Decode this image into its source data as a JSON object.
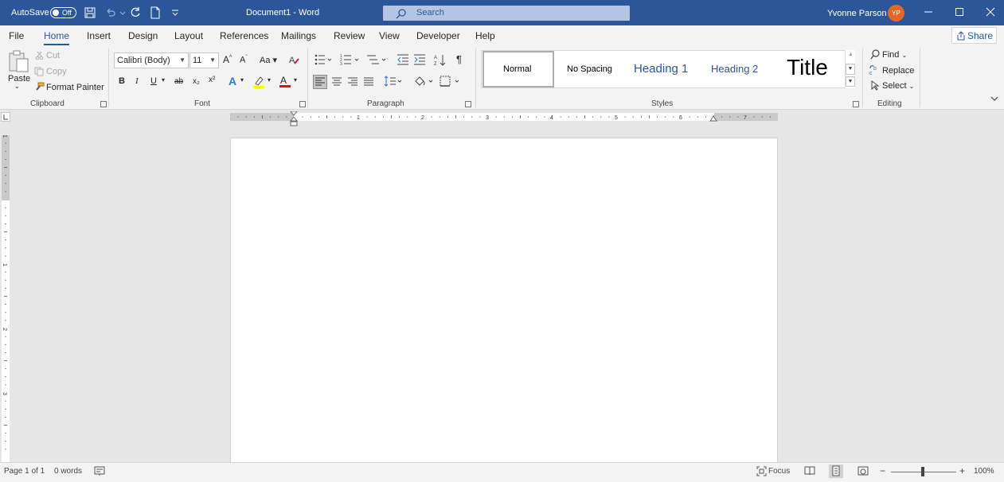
{
  "titlebar": {
    "autosave_label": "AutoSave",
    "autosave_state": "Off",
    "document_title": "Document1  -  Word",
    "search_placeholder": "Search",
    "user_name": "Yvonne Parson",
    "user_initials": "YP"
  },
  "tabs": [
    "File",
    "Home",
    "Insert",
    "Design",
    "Layout",
    "References",
    "Mailings",
    "Review",
    "View",
    "Developer",
    "Help"
  ],
  "active_tab": "Home",
  "share_label": "Share",
  "clipboard": {
    "paste": "Paste",
    "cut": "Cut",
    "copy": "Copy",
    "format_painter": "Format Painter",
    "group_label": "Clipboard"
  },
  "font": {
    "font_name": "Calibri (Body)",
    "font_size": "11",
    "case_label": "Aa",
    "bold": "B",
    "italic": "I",
    "underline": "U",
    "strikethrough": "ab",
    "subscript": "x₂",
    "superscript": "x²",
    "text_effects": "A",
    "font_color": "A",
    "group_label": "Font"
  },
  "paragraph": {
    "pilcrow": "¶",
    "group_label": "Paragraph"
  },
  "styles": {
    "items": [
      "Normal",
      "No Spacing",
      "Heading 1",
      "Heading 2",
      "Title"
    ],
    "group_label": "Styles"
  },
  "editing": {
    "find": "Find",
    "replace": "Replace",
    "select": "Select",
    "group_label": "Editing"
  },
  "ruler": {
    "h_numbers": [
      "1",
      "1",
      "2",
      "3",
      "4",
      "5",
      "6",
      "7"
    ],
    "v_numbers": [
      "1",
      "1",
      "2",
      "3"
    ]
  },
  "statusbar": {
    "page": "Page 1 of 1",
    "words": "0 words",
    "focus": "Focus",
    "zoom": "100%",
    "zoom_minus": "−",
    "zoom_plus": "+"
  },
  "colors": {
    "accent": "#2b579a",
    "avatar": "#e3672b",
    "highlight": "#ffff00",
    "font_color_bar": "#ff0000",
    "heading_blue": "#2f5496"
  }
}
